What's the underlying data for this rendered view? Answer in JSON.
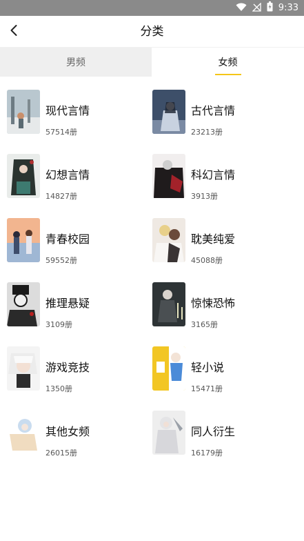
{
  "status_bar": {
    "time": "9:33"
  },
  "header": {
    "title": "分类"
  },
  "tabs": [
    {
      "label": "男频"
    },
    {
      "label": "女频"
    }
  ],
  "categories": [
    {
      "name": "现代言情",
      "count": "57514册"
    },
    {
      "name": "古代言情",
      "count": "23213册"
    },
    {
      "name": "幻想言情",
      "count": "14827册"
    },
    {
      "name": "科幻言情",
      "count": "3913册"
    },
    {
      "name": "青春校园",
      "count": "59552册"
    },
    {
      "name": "耽美纯爱",
      "count": "45088册"
    },
    {
      "name": "推理悬疑",
      "count": "3109册"
    },
    {
      "name": "惊悚恐怖",
      "count": "3165册"
    },
    {
      "name": "游戏竞技",
      "count": "1350册"
    },
    {
      "name": "轻小说",
      "count": "15471册"
    },
    {
      "name": "其他女频",
      "count": "26015册"
    },
    {
      "name": "同人衍生",
      "count": "16179册"
    }
  ]
}
